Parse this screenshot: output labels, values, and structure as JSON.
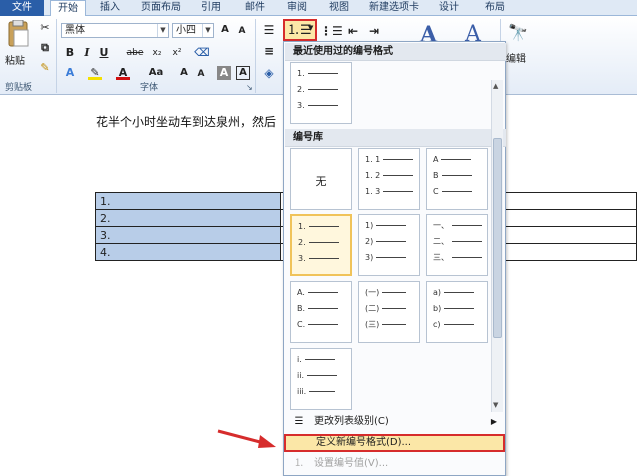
{
  "tabs": [
    "文件",
    "开始",
    "插入",
    "页面布局",
    "引用",
    "邮件",
    "审阅",
    "视图",
    "新建选项卡",
    "设计",
    "布局"
  ],
  "ribbon": {
    "clipboard": {
      "paste_label": "粘贴",
      "group_label": "剪贴板"
    },
    "font": {
      "name": "黑体",
      "size": "小四",
      "group_label": "字体",
      "bold": "B",
      "italic": "I",
      "underline": "U",
      "strike": "abe",
      "sub": "x₂",
      "sup": "x²",
      "grow": "A",
      "shrink": "A",
      "change_case": "Aa",
      "char_border": "A"
    },
    "editing_label": "编辑"
  },
  "document": {
    "text_line": "花半个小时坐动车到达泉州，然后",
    "rows": [
      "1.",
      "2.",
      "3.",
      "4."
    ]
  },
  "panel": {
    "recent_header": "最近使用过的编号格式",
    "library_header": "编号库",
    "recent_tile": [
      "1.",
      "2.",
      "3."
    ],
    "none_label": "无",
    "tiles": [
      [
        "1. 1",
        "1. 2",
        "1. 3"
      ],
      [
        "A",
        "B",
        "C"
      ],
      [
        "1.",
        "2.",
        "3."
      ],
      [
        "1)",
        "2)",
        "3)"
      ],
      [
        "一、",
        "二、",
        "三、"
      ],
      [
        "A.",
        "B.",
        "C."
      ],
      [
        "(一)",
        "(二)",
        "(三)"
      ],
      [
        "a)",
        "b)",
        "c)"
      ],
      [
        "i.",
        "ii.",
        "iii."
      ]
    ],
    "menu": {
      "change_level": "更改列表级别(C)",
      "define_new": "定义新编号格式(D)...",
      "set_value": "设置编号值(V)..."
    }
  },
  "colors": {
    "highlight_border": "#d62c2c",
    "selection": "#b8cde8",
    "file_tab": "#2a5ea8"
  }
}
